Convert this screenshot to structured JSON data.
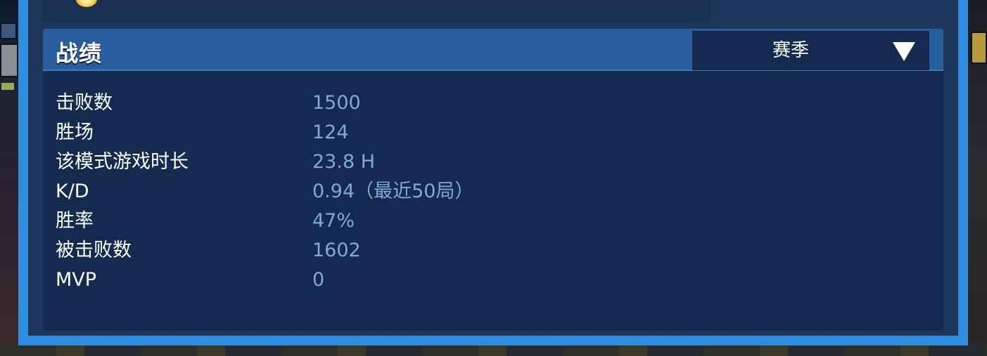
{
  "stats": {
    "title": "战绩",
    "season_select": {
      "selected": "赛季",
      "icon": "triangle-down-icon"
    },
    "rows": [
      {
        "label": "击败数",
        "value": "1500"
      },
      {
        "label": "胜场",
        "value": "124"
      },
      {
        "label": "该模式游戏时长",
        "value": "23.8 H"
      },
      {
        "label": "K/D",
        "value": "0.94（最近50局）"
      },
      {
        "label": "胜率",
        "value": "47%"
      },
      {
        "label": "被击败数",
        "value": "1602"
      },
      {
        "label": "MVP",
        "value": "0"
      }
    ]
  },
  "colors": {
    "frame": "#2f8ee0",
    "header": "#2a5d9c",
    "panel": "#142a4e",
    "value_text": "#7ea9db",
    "label_text": "#ffffff"
  }
}
